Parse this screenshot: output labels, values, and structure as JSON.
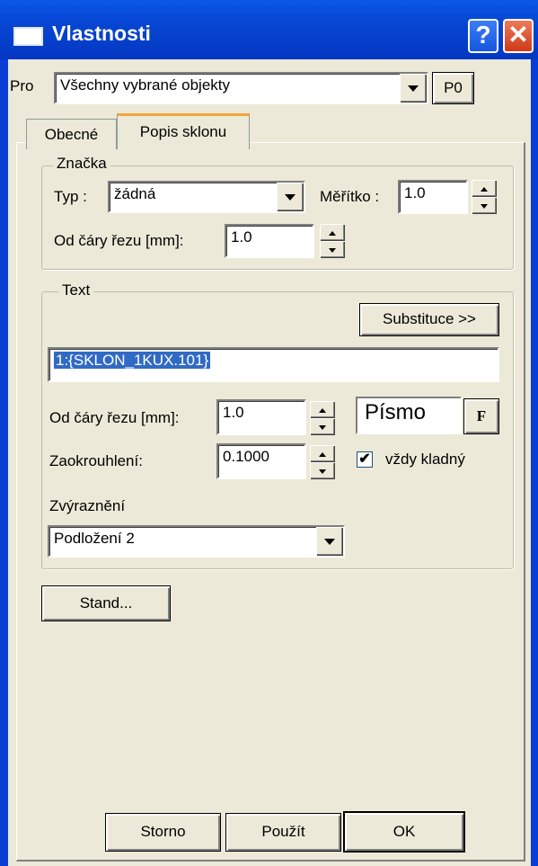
{
  "window": {
    "title": "Vlastnosti",
    "help_icon": "question-mark-icon",
    "close_icon": "close-x-icon",
    "help_glyph": "?",
    "close_glyph": "✕"
  },
  "pro": {
    "label": "Pro",
    "value": "Všechny vybrané objekty",
    "p0_label": "P0"
  },
  "tabs": [
    {
      "label": "Obecné",
      "active": false
    },
    {
      "label": "Popis sklonu",
      "active": true
    }
  ],
  "znacka": {
    "title": "Značka",
    "typ_label": "Typ :",
    "typ_value": "žádná",
    "meritko_label": "Měřítko :",
    "meritko_value": "1.0",
    "od_cary_label": "Od čáry řezu [mm]:",
    "od_cary_value": "1.0"
  },
  "text": {
    "title": "Text",
    "substituce_label": "Substituce >>",
    "expression": "1:{SKLON_1KUX.101}",
    "od_cary_label": "Od čáry řezu [mm]:",
    "od_cary_value": "1.0",
    "pismo_label": "Písmo",
    "font_button_glyph": "F",
    "zaokrouhleni_label": "Zaokrouhlení:",
    "zaokrouhleni_value": "0.1000",
    "vzdy_kladny_label": "vždy kladný",
    "vzdy_kladny_checked": true,
    "check_glyph": "✔",
    "zvyrazneni_label": "Zvýraznění",
    "zvyrazneni_value": "Podložení 2"
  },
  "stand_label": "Stand...",
  "footer": {
    "storno": "Storno",
    "pouzit": "Použít",
    "ok": "OK"
  },
  "colors": {
    "titlebar": "#0646d2",
    "face": "#ece9d8",
    "selection": "#316ac5",
    "close_button": "#cf3a18"
  }
}
